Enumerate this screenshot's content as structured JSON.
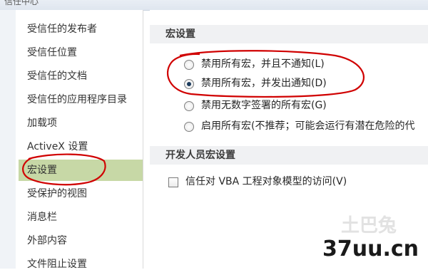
{
  "window": {
    "title": "信任中心"
  },
  "sidebar": {
    "items": [
      {
        "label": "受信任的发布者"
      },
      {
        "label": "受信任位置"
      },
      {
        "label": "受信任的文档"
      },
      {
        "label": "受信任的应用程序目录"
      },
      {
        "label": "加载项"
      },
      {
        "label": "ActiveX 设置"
      },
      {
        "label": "宏设置",
        "selected": true
      },
      {
        "label": "受保护的视图"
      },
      {
        "label": "消息栏"
      },
      {
        "label": "外部内容"
      },
      {
        "label": "文件阻止设置"
      }
    ]
  },
  "macro_settings": {
    "header": "宏设置",
    "options": [
      {
        "label": "禁用所有宏，并且不通知(L)",
        "checked": false
      },
      {
        "label": "禁用所有宏，并发出通知(D)",
        "checked": true
      },
      {
        "label": "禁用无数字签署的所有宏(G)",
        "checked": false
      },
      {
        "label": "启用所有宏(不推荐；可能会运行有潜在危险的代",
        "checked": false
      }
    ]
  },
  "developer_settings": {
    "header": "开发人员宏设置",
    "trust_vba_label": "信任对 VBA 工程对象模型的访问(V)",
    "trust_vba_checked": false
  },
  "watermark": {
    "text": "37uu.cn",
    "logo_text": "土巴兔"
  },
  "colors": {
    "selected_item": "#c7d8a6",
    "annotation": "#d00000",
    "section_header_bg": "#f0f1f3"
  }
}
